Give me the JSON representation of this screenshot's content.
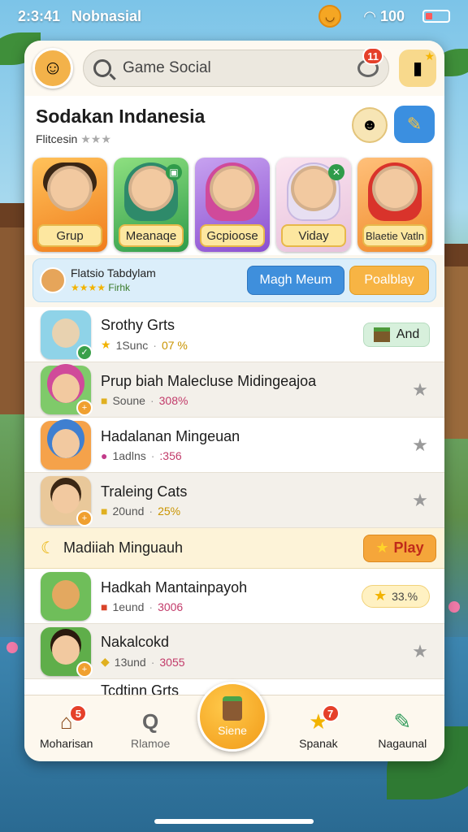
{
  "status": {
    "time": "2:3:41",
    "carrier": "Nobnasial",
    "signal": "100"
  },
  "search": {
    "placeholder": "Game Social",
    "badge": "11"
  },
  "section": {
    "title": "Sodakan Indanesia",
    "subtitle": "Flitcesin"
  },
  "cards": [
    {
      "label": "Grup",
      "bg": "#f8a23a"
    },
    {
      "label": "Meanaqe",
      "bg": "#5fc05a"
    },
    {
      "label": "Gcpioose",
      "bg": "#a86ad8"
    },
    {
      "label": "Viday",
      "bg": "#f3d2e8"
    },
    {
      "label": "Blaetie Vatln",
      "bg": "#f7a544"
    }
  ],
  "banner": {
    "title": "Flatsio Tabdylam",
    "sub": "Firhk",
    "blue_button": "Magh Meum",
    "orange_button": "Poalblay"
  },
  "rows": [
    {
      "title": "Srothy Grts",
      "meta": "1Sunc",
      "pct": "07 %",
      "action": "And"
    },
    {
      "title": "Prup biah Malecluse Midingeajoa",
      "meta": "Soune",
      "pct": "308%"
    },
    {
      "title": "Hadalanan Mingeuan",
      "meta": "1adlns",
      "pct": ":356"
    },
    {
      "title": "Traleing Cats",
      "meta": "20und",
      "pct": "25%"
    }
  ],
  "promo": {
    "text": "Madiiah Minguauh",
    "button": "Play"
  },
  "rows2": [
    {
      "title": "Hadkah Mantainpayoh",
      "meta": "1eund",
      "pct": "3006",
      "pill": "33.%"
    },
    {
      "title": "Nakalcokd",
      "meta": "13und",
      "pct": "3055"
    }
  ],
  "partial_row": "Tcdtinn Grts",
  "nav": {
    "items": [
      {
        "label": "Moharisan",
        "badge": "5"
      },
      {
        "label": "Rlamoe"
      },
      {
        "label": "Siene"
      },
      {
        "label": "Spanak",
        "badge": "7"
      },
      {
        "label": "Nagaunal"
      }
    ]
  },
  "colors": {
    "accent_blue": "#3f8fdc",
    "accent_orange": "#f5a63a",
    "badge_red": "#e5402a",
    "panel_bg": "#fbf6ec"
  }
}
